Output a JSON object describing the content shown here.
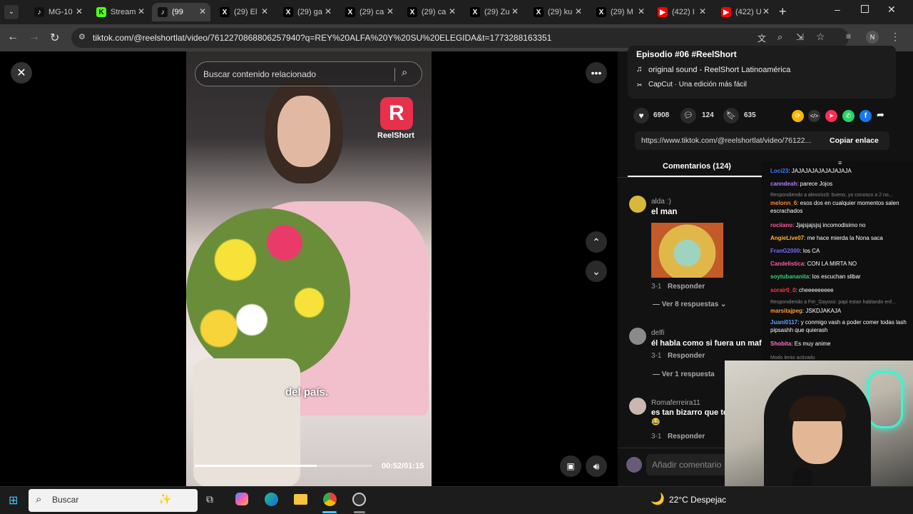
{
  "tabs": [
    {
      "label": "MG-10",
      "icon": "tiktok-icon",
      "color": "#111111"
    },
    {
      "label": "Stream",
      "icon": "kick-icon",
      "color": "#53fc18"
    },
    {
      "label": "(99",
      "icon": "tiktok-icon",
      "color": "#111111"
    },
    {
      "label": "(29) El",
      "icon": "x-icon",
      "color": "#000000"
    },
    {
      "label": "(29) ga",
      "icon": "x-icon",
      "color": "#000000"
    },
    {
      "label": "(29) ca",
      "icon": "x-icon",
      "color": "#000000"
    },
    {
      "label": "(29) ca",
      "icon": "x-icon",
      "color": "#000000"
    },
    {
      "label": "(29) Zu",
      "icon": "x-icon",
      "color": "#000000"
    },
    {
      "label": "(29) ku",
      "icon": "x-icon",
      "color": "#000000"
    },
    {
      "label": "(29) M",
      "icon": "x-icon",
      "color": "#000000"
    },
    {
      "label": "(422) I",
      "icon": "youtube-icon",
      "color": "#ff0000"
    },
    {
      "label": "(422) U",
      "icon": "youtube-icon",
      "color": "#ff0000"
    }
  ],
  "url": "tiktok.com/@reelshortlat/video/7612270868806257940?q=REY%20ALFA%20Y%20SU%20ELEGIDA&t=1773288163351",
  "profile_initial": "N",
  "search": {
    "placeholder": "Buscar contenido relacionado"
  },
  "video": {
    "brand": "ReelShort",
    "subtitle": "del país.",
    "time": "00:52/01:15",
    "progress": 0.69
  },
  "info": {
    "title": "Episodio #06 #ReelShort",
    "sound": "original sound - ReelShort Latinoamérica",
    "capcut": "CapCut · Una edición más fácil",
    "likes": "6908",
    "comments": "124",
    "saves": "635",
    "link": "https://www.tiktok.com/@reelshortlat/video/76122...",
    "copy_label": "Copiar enlace",
    "comments_tab": "Comentarios (124)"
  },
  "comments": [
    {
      "user": "alda :)",
      "text": "el man",
      "meta": "3-1",
      "reply": "Responder",
      "more": "Ver 8 respuestas"
    },
    {
      "user": "delfi",
      "text": "él habla como si fuera un mafic",
      "meta": "3-1",
      "reply": "Responder",
      "more": "Ver 1 respuesta"
    },
    {
      "user": "Romaferreira11",
      "text": "es tan bizarro que te",
      "emoji": "😂",
      "meta": "3-1",
      "reply": "Responder"
    }
  ],
  "add_comment": "Añadir comentario",
  "chat": [
    {
      "user": "Loci23",
      "color": "#3a7dff",
      "text": "JAJAJAJAJAJAJAJAJA"
    },
    {
      "user": "canndeah",
      "color": "#b47bff",
      "text": "parece Jojos"
    },
    {
      "note": "Respondiendo a alexxiss9: bueno, yo conosco a 2 no..."
    },
    {
      "user": "melonn_6",
      "color": "#ff8a2a",
      "text": "esos dos en cualquier momentos salen escrachados"
    },
    {
      "user": "rociiano",
      "color": "#ff5c9a",
      "text": "Jjajsjajsjsj incomodisimo no"
    },
    {
      "user": "AngieLive07",
      "color": "#ffb52a",
      "text": "me hace mierda la Nona saca"
    },
    {
      "user": "FranG2000",
      "color": "#7a6bff",
      "text": "los CA"
    },
    {
      "user": "Candelistica",
      "color": "#ff5ca8",
      "text": "CON LA MIRTA NO"
    },
    {
      "user": "soytubananita",
      "color": "#3ad07a",
      "text": "los escuchan slibar"
    },
    {
      "user": "sorair0_0",
      "color": "#ff3a3a",
      "text": "cheeeeeeeee"
    },
    {
      "note": "Respondiendo a Fer_Gayoso: papi estan hablando enf..."
    },
    {
      "user": "marsitajpeg",
      "color": "#ff9a3a",
      "text": "JSKDJAKAJA"
    },
    {
      "user": "Juani0117",
      "color": "#5aa0ff",
      "text": "y conmigo vash a poder comer todas lash pipsashh que quierash"
    },
    {
      "user": "Shobita",
      "color": "#ff6fcf",
      "text": "Es muy anime"
    },
    {
      "note": "Modo lento activado"
    }
  ],
  "taskbar": {
    "search_label": "Buscar",
    "weather": "22°C Despejac"
  }
}
